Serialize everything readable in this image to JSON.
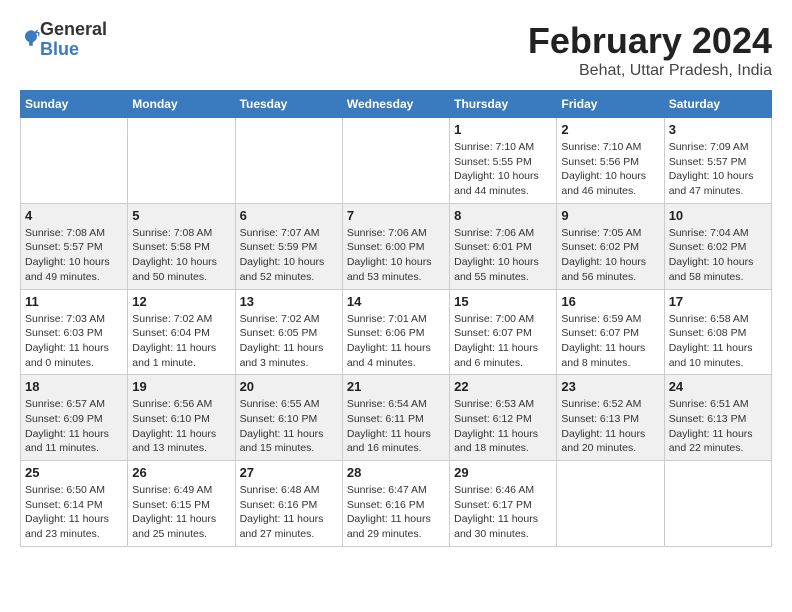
{
  "header": {
    "logo_general": "General",
    "logo_blue": "Blue",
    "month_title": "February 2024",
    "location": "Behat, Uttar Pradesh, India"
  },
  "weekdays": [
    "Sunday",
    "Monday",
    "Tuesday",
    "Wednesday",
    "Thursday",
    "Friday",
    "Saturday"
  ],
  "weeks": [
    [
      {
        "day": "",
        "sunrise": "",
        "sunset": "",
        "daylight": ""
      },
      {
        "day": "",
        "sunrise": "",
        "sunset": "",
        "daylight": ""
      },
      {
        "day": "",
        "sunrise": "",
        "sunset": "",
        "daylight": ""
      },
      {
        "day": "",
        "sunrise": "",
        "sunset": "",
        "daylight": ""
      },
      {
        "day": "1",
        "sunrise": "Sunrise: 7:10 AM",
        "sunset": "Sunset: 5:55 PM",
        "daylight": "Daylight: 10 hours and 44 minutes."
      },
      {
        "day": "2",
        "sunrise": "Sunrise: 7:10 AM",
        "sunset": "Sunset: 5:56 PM",
        "daylight": "Daylight: 10 hours and 46 minutes."
      },
      {
        "day": "3",
        "sunrise": "Sunrise: 7:09 AM",
        "sunset": "Sunset: 5:57 PM",
        "daylight": "Daylight: 10 hours and 47 minutes."
      }
    ],
    [
      {
        "day": "4",
        "sunrise": "Sunrise: 7:08 AM",
        "sunset": "Sunset: 5:57 PM",
        "daylight": "Daylight: 10 hours and 49 minutes."
      },
      {
        "day": "5",
        "sunrise": "Sunrise: 7:08 AM",
        "sunset": "Sunset: 5:58 PM",
        "daylight": "Daylight: 10 hours and 50 minutes."
      },
      {
        "day": "6",
        "sunrise": "Sunrise: 7:07 AM",
        "sunset": "Sunset: 5:59 PM",
        "daylight": "Daylight: 10 hours and 52 minutes."
      },
      {
        "day": "7",
        "sunrise": "Sunrise: 7:06 AM",
        "sunset": "Sunset: 6:00 PM",
        "daylight": "Daylight: 10 hours and 53 minutes."
      },
      {
        "day": "8",
        "sunrise": "Sunrise: 7:06 AM",
        "sunset": "Sunset: 6:01 PM",
        "daylight": "Daylight: 10 hours and 55 minutes."
      },
      {
        "day": "9",
        "sunrise": "Sunrise: 7:05 AM",
        "sunset": "Sunset: 6:02 PM",
        "daylight": "Daylight: 10 hours and 56 minutes."
      },
      {
        "day": "10",
        "sunrise": "Sunrise: 7:04 AM",
        "sunset": "Sunset: 6:02 PM",
        "daylight": "Daylight: 10 hours and 58 minutes."
      }
    ],
    [
      {
        "day": "11",
        "sunrise": "Sunrise: 7:03 AM",
        "sunset": "Sunset: 6:03 PM",
        "daylight": "Daylight: 11 hours and 0 minutes."
      },
      {
        "day": "12",
        "sunrise": "Sunrise: 7:02 AM",
        "sunset": "Sunset: 6:04 PM",
        "daylight": "Daylight: 11 hours and 1 minute."
      },
      {
        "day": "13",
        "sunrise": "Sunrise: 7:02 AM",
        "sunset": "Sunset: 6:05 PM",
        "daylight": "Daylight: 11 hours and 3 minutes."
      },
      {
        "day": "14",
        "sunrise": "Sunrise: 7:01 AM",
        "sunset": "Sunset: 6:06 PM",
        "daylight": "Daylight: 11 hours and 4 minutes."
      },
      {
        "day": "15",
        "sunrise": "Sunrise: 7:00 AM",
        "sunset": "Sunset: 6:07 PM",
        "daylight": "Daylight: 11 hours and 6 minutes."
      },
      {
        "day": "16",
        "sunrise": "Sunrise: 6:59 AM",
        "sunset": "Sunset: 6:07 PM",
        "daylight": "Daylight: 11 hours and 8 minutes."
      },
      {
        "day": "17",
        "sunrise": "Sunrise: 6:58 AM",
        "sunset": "Sunset: 6:08 PM",
        "daylight": "Daylight: 11 hours and 10 minutes."
      }
    ],
    [
      {
        "day": "18",
        "sunrise": "Sunrise: 6:57 AM",
        "sunset": "Sunset: 6:09 PM",
        "daylight": "Daylight: 11 hours and 11 minutes."
      },
      {
        "day": "19",
        "sunrise": "Sunrise: 6:56 AM",
        "sunset": "Sunset: 6:10 PM",
        "daylight": "Daylight: 11 hours and 13 minutes."
      },
      {
        "day": "20",
        "sunrise": "Sunrise: 6:55 AM",
        "sunset": "Sunset: 6:10 PM",
        "daylight": "Daylight: 11 hours and 15 minutes."
      },
      {
        "day": "21",
        "sunrise": "Sunrise: 6:54 AM",
        "sunset": "Sunset: 6:11 PM",
        "daylight": "Daylight: 11 hours and 16 minutes."
      },
      {
        "day": "22",
        "sunrise": "Sunrise: 6:53 AM",
        "sunset": "Sunset: 6:12 PM",
        "daylight": "Daylight: 11 hours and 18 minutes."
      },
      {
        "day": "23",
        "sunrise": "Sunrise: 6:52 AM",
        "sunset": "Sunset: 6:13 PM",
        "daylight": "Daylight: 11 hours and 20 minutes."
      },
      {
        "day": "24",
        "sunrise": "Sunrise: 6:51 AM",
        "sunset": "Sunset: 6:13 PM",
        "daylight": "Daylight: 11 hours and 22 minutes."
      }
    ],
    [
      {
        "day": "25",
        "sunrise": "Sunrise: 6:50 AM",
        "sunset": "Sunset: 6:14 PM",
        "daylight": "Daylight: 11 hours and 23 minutes."
      },
      {
        "day": "26",
        "sunrise": "Sunrise: 6:49 AM",
        "sunset": "Sunset: 6:15 PM",
        "daylight": "Daylight: 11 hours and 25 minutes."
      },
      {
        "day": "27",
        "sunrise": "Sunrise: 6:48 AM",
        "sunset": "Sunset: 6:16 PM",
        "daylight": "Daylight: 11 hours and 27 minutes."
      },
      {
        "day": "28",
        "sunrise": "Sunrise: 6:47 AM",
        "sunset": "Sunset: 6:16 PM",
        "daylight": "Daylight: 11 hours and 29 minutes."
      },
      {
        "day": "29",
        "sunrise": "Sunrise: 6:46 AM",
        "sunset": "Sunset: 6:17 PM",
        "daylight": "Daylight: 11 hours and 30 minutes."
      },
      {
        "day": "",
        "sunrise": "",
        "sunset": "",
        "daylight": ""
      },
      {
        "day": "",
        "sunrise": "",
        "sunset": "",
        "daylight": ""
      }
    ]
  ]
}
